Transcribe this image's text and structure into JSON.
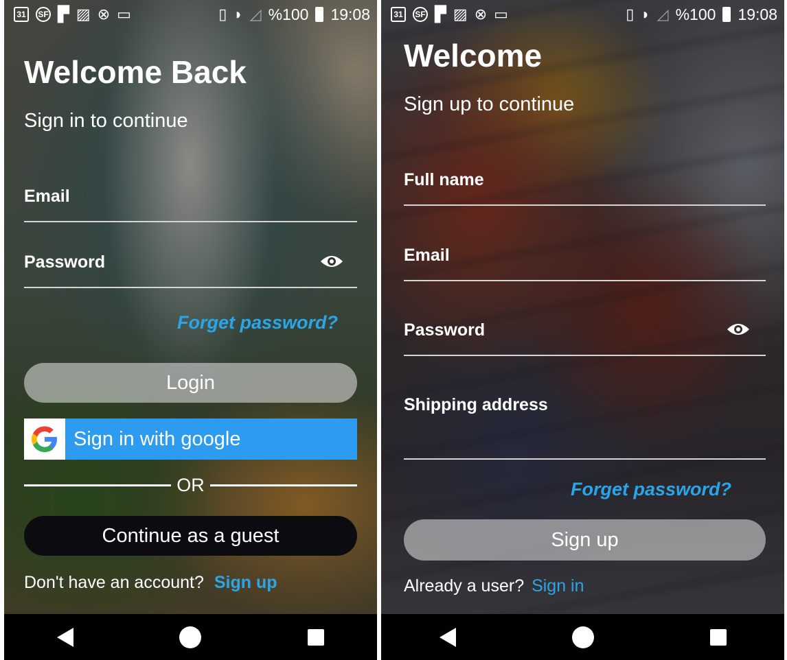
{
  "status_bar": {
    "left_icons": [
      "calendar-31-icon",
      "sf-icon",
      "flag-icon",
      "image-icon",
      "crossed-settings-icon",
      "window-icon"
    ],
    "calendar_text": "31",
    "sf_text": "SF",
    "battery_text": "%100",
    "time": "19:08"
  },
  "login_screen": {
    "title": "Welcome Back",
    "subtitle": "Sign in to continue",
    "email_label": "Email",
    "password_label": "Password",
    "forget_password": "Forget password?",
    "login_button": "Login",
    "google_button": "Sign in with google",
    "or_text": "OR",
    "guest_button": "Continue as a guest",
    "no_account_text": "Don't have an account?",
    "signup_link": "Sign up"
  },
  "signup_screen": {
    "title": "Welcome",
    "subtitle": "Sign up to continue",
    "fullname_label": "Full name",
    "email_label": "Email",
    "password_label": "Password",
    "shipping_label": "Shipping address",
    "forget_password": "Forget password?",
    "signup_button": "Sign up",
    "already_user_text": "Already a user?",
    "signin_link": "Sign in"
  },
  "colors": {
    "link_blue": "#2aa6e8",
    "google_blue": "#2d9cf0",
    "guest_black": "#0b0b10"
  }
}
